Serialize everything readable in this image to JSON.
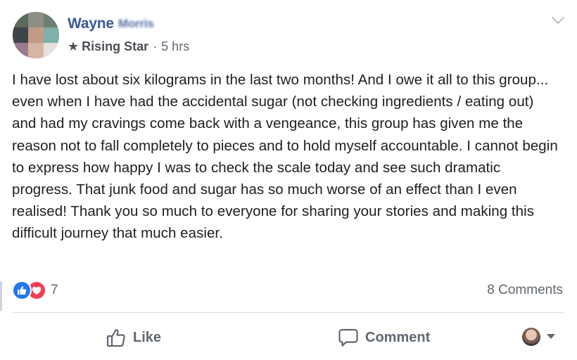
{
  "post": {
    "author_first": "Wayne",
    "author_last": "Morris",
    "badge": "Rising Star",
    "separator": "·",
    "time": "5 hrs",
    "text": "I have lost about six kilograms in the last two months! And I owe it all to this group... even when I have had the accidental sugar (not checking ingredients / eating out) and had my cravings come back with a vengeance, this group has given me the reason not to fall completely to pieces and to hold myself accountable. I cannot begin to express how happy I was to check the scale today and see such dramatic progress. That junk food and sugar has so much worse of an effect than I even realised! Thank you so much to everyone for sharing your stories and making this difficult journey that much easier."
  },
  "reactions": {
    "types": [
      "like",
      "love"
    ],
    "count": "7"
  },
  "comments_count": "8 Comments",
  "actions": {
    "like_label": "Like",
    "comment_label": "Comment"
  },
  "colors": {
    "link": "#385898",
    "like": "#2078f4",
    "love": "#f33e58",
    "muted": "#606770"
  },
  "icons": {
    "badge": "star-icon",
    "options": "chevron-down-icon",
    "like": "thumbs-up-icon",
    "comment": "speech-bubble-icon",
    "audience": "caret-down-icon"
  }
}
